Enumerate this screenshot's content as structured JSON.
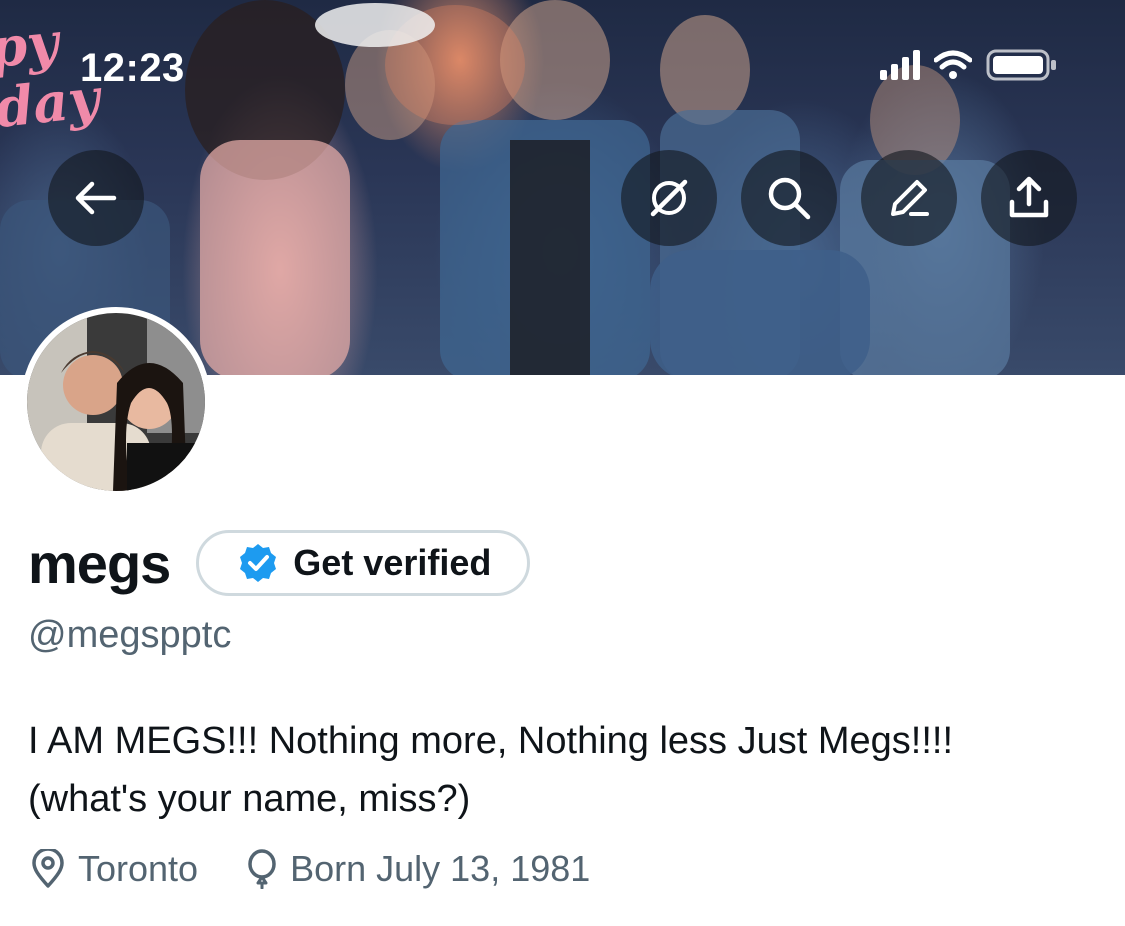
{
  "status_bar": {
    "time": "12:23"
  },
  "banner": {
    "photo_text": "py\nday"
  },
  "header_actions": {
    "back": "back-arrow",
    "grok": "grok",
    "search": "search",
    "compose": "compose",
    "share": "share"
  },
  "profile": {
    "display_name": "megs",
    "verify_label": "Get verified",
    "handle": "@megspptc",
    "bio_line1": "I AM MEGS!!! Nothing more, Nothing less Just Megs!!!!",
    "bio_line2": "(what's your name, miss?)",
    "location": "Toronto",
    "birthday": "Born July 13, 1981"
  },
  "colors": {
    "accent": "#1d9bf0",
    "secondary_text": "#536471",
    "primary_text": "#0f1419",
    "border": "#cfd9de"
  }
}
